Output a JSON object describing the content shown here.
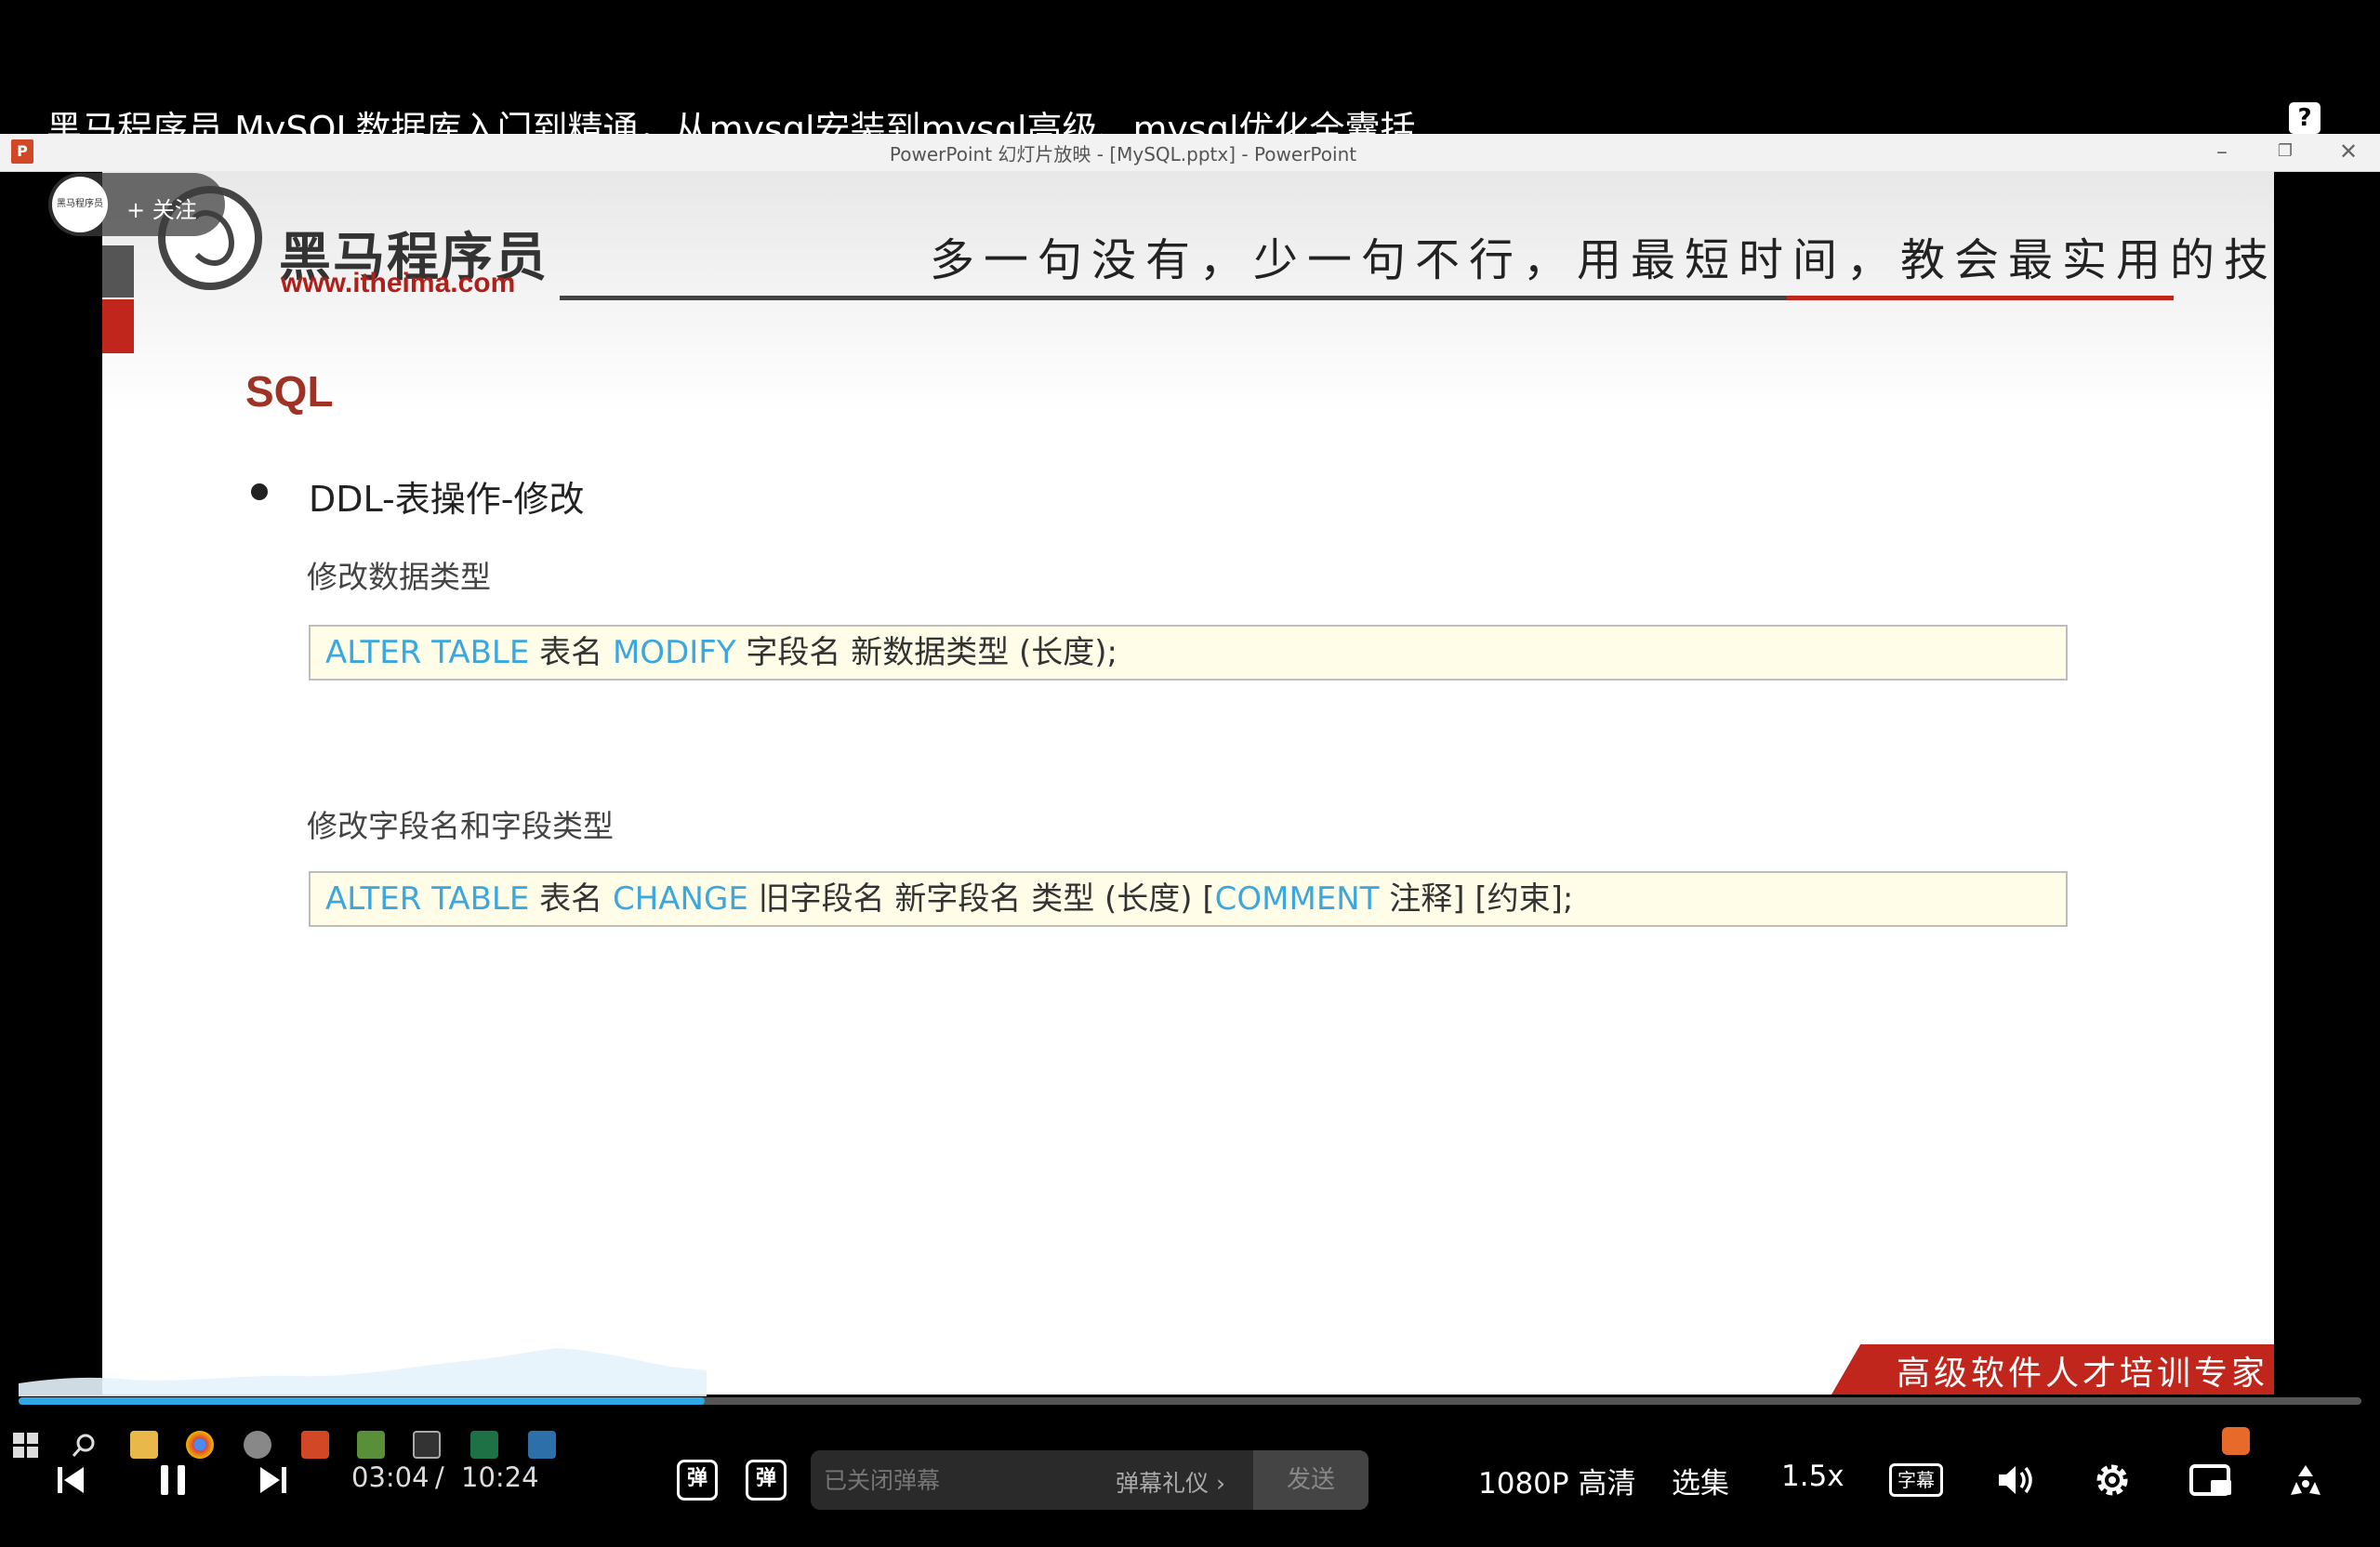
{
  "video": {
    "title": "黑马程序员 MySQL数据库入门到精通，从mysql安装到mysql高级、mysql优化全囊括",
    "help_icon_text": "?",
    "uploader": {
      "avatar_text": "黑马程序员",
      "follow_label": "+ 关注"
    }
  },
  "ppt_window": {
    "logo_text": "P",
    "title": "PowerPoint 幻灯片放映 - [MySQL.pptx] - PowerPoint",
    "minimize": "–",
    "restore": "❐",
    "close": "✕"
  },
  "slide": {
    "brand_cn": "黑马程序员",
    "brand_url": "www.itheima.com",
    "motto": "多一句没有，少一句不行，用最短时间，教会最实用的技术！",
    "heading": "SQL",
    "bullet": "DDL-表操作-修改",
    "section1": {
      "title": "修改数据类型",
      "code": [
        {
          "text": "ALTER TABLE",
          "kw": true
        },
        {
          "text": " 表名 ",
          "kw": false
        },
        {
          "text": "MODIFY",
          "kw": true
        },
        {
          "text": "  字段名  新数据类型 (长度);",
          "kw": false
        }
      ]
    },
    "section2": {
      "title": "修改字段名和字段类型",
      "code": [
        {
          "text": "ALTER TABLE",
          "kw": true
        },
        {
          "text": " 表名 ",
          "kw": false
        },
        {
          "text": "CHANGE",
          "kw": true
        },
        {
          "text": "  旧字段名  新字段名  类型 (长度)  [",
          "kw": false
        },
        {
          "text": "COMMENT",
          "kw": true
        },
        {
          "text": " 注释]  [约束];",
          "kw": false
        }
      ]
    },
    "footer_slogan": "高级软件人才培训专家",
    "colors": {
      "accent_red": "#c0261c",
      "keyword_blue": "#3aa7e0",
      "heading_red": "#9e3325",
      "code_bg": "#fffde8"
    }
  },
  "player": {
    "progress_fraction": 0.293,
    "time_current": "03:04",
    "time_separator": "/",
    "time_total": "10:24",
    "danmaku_toggle_label": "弹",
    "danmaku_settings_label": "弹",
    "danmaku_placeholder": "已关闭弹幕",
    "danmaku_etiquette": "弹幕礼仪 ›",
    "send_label": "发送",
    "quality": "1080P 高清",
    "episodes": "选集",
    "speed": "1.5x",
    "subtitle_label": "字幕",
    "colors": {
      "progress": "#2fa7e2"
    },
    "icons": [
      "prev-icon",
      "pause-icon",
      "next-icon",
      "volume-icon",
      "settings-gear-icon",
      "pip-icon",
      "fullscreen-icon"
    ]
  }
}
